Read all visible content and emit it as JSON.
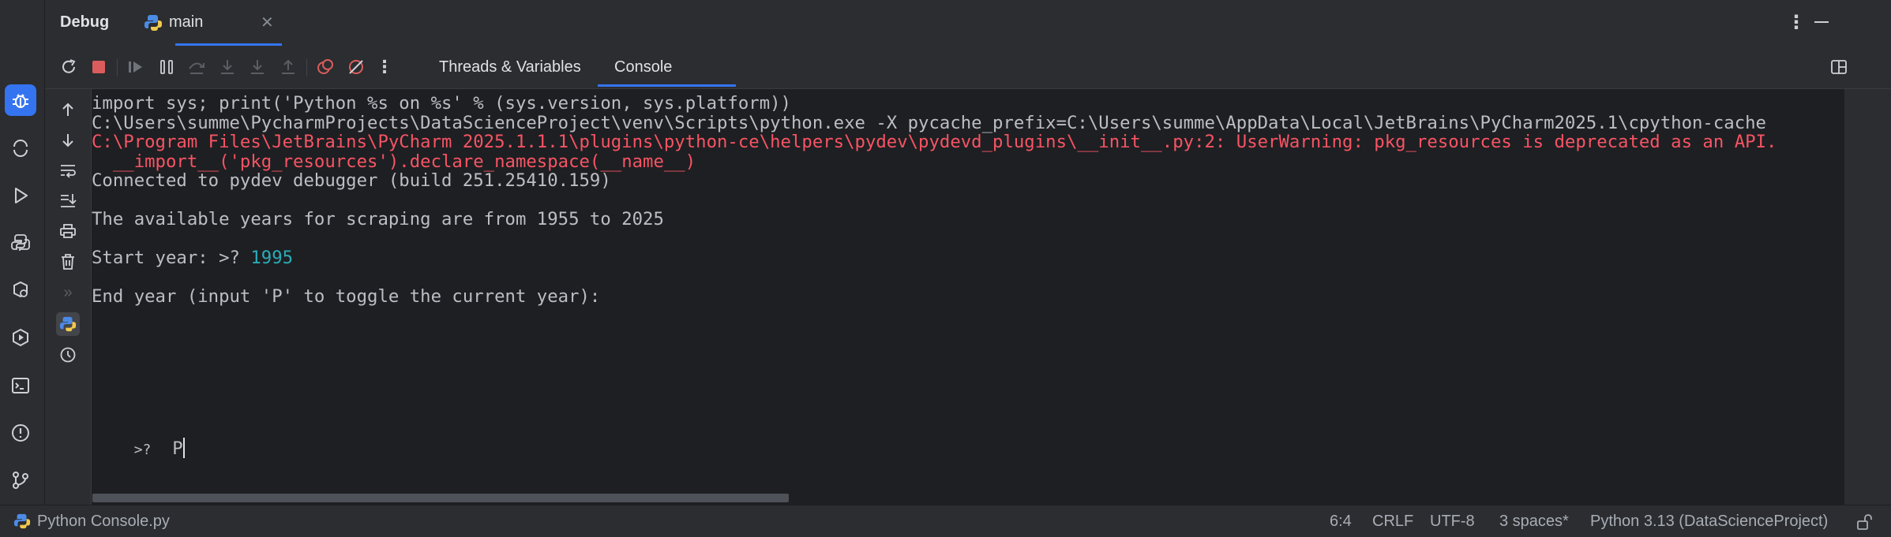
{
  "title_bar": {
    "panel_title": "Debug",
    "run_tab_label": "main"
  },
  "toolbar": {
    "tabs": [
      "Threads & Variables",
      "Console"
    ],
    "active_tab": "Console"
  },
  "console": {
    "lines": [
      {
        "text": "import sys; print('Python %s on %s' % (sys.version, sys.platform))",
        "kind": "normal"
      },
      {
        "text": "C:\\Users\\summe\\PycharmProjects\\DataScienceProject\\venv\\Scripts\\python.exe -X pycache_prefix=C:\\Users\\summe\\AppData\\Local\\JetBrains\\PyCharm2025.1\\cpython-cache",
        "kind": "normal"
      },
      {
        "text": "C:\\Program Files\\JetBrains\\PyCharm 2025.1.1.1\\plugins\\python-ce\\helpers\\pydev\\pydevd_plugins\\__init__.py:2: UserWarning: pkg_resources is deprecated as an API.",
        "kind": "error"
      },
      {
        "text": "  __import__('pkg_resources').declare_namespace(__name__)",
        "kind": "error"
      },
      {
        "text": "Connected to pydev debugger (build 251.25410.159)",
        "kind": "normal"
      },
      {
        "text": "",
        "kind": "normal"
      },
      {
        "text": "The available years for scraping are from 1955 to 2025",
        "kind": "normal"
      },
      {
        "text": "",
        "kind": "normal"
      },
      {
        "text": "Start year: >? ",
        "kind": "normal",
        "input": "1995"
      },
      {
        "text": "",
        "kind": "normal"
      },
      {
        "text": "End year (input 'P' to toggle the current year):",
        "kind": "normal"
      }
    ],
    "prompt": ">?",
    "input_value": "P"
  },
  "status_bar": {
    "file_label": "Python Console.py",
    "position": "6:4",
    "line_ending": "CRLF",
    "encoding": "UTF-8",
    "indent": "3 spaces*",
    "interpreter": "Python 3.13 (DataScienceProject)"
  },
  "colors": {
    "accent": "#3574f0",
    "error_text": "#f75464",
    "user_input": "#2aacb8",
    "stop_red": "#db5c5c"
  }
}
